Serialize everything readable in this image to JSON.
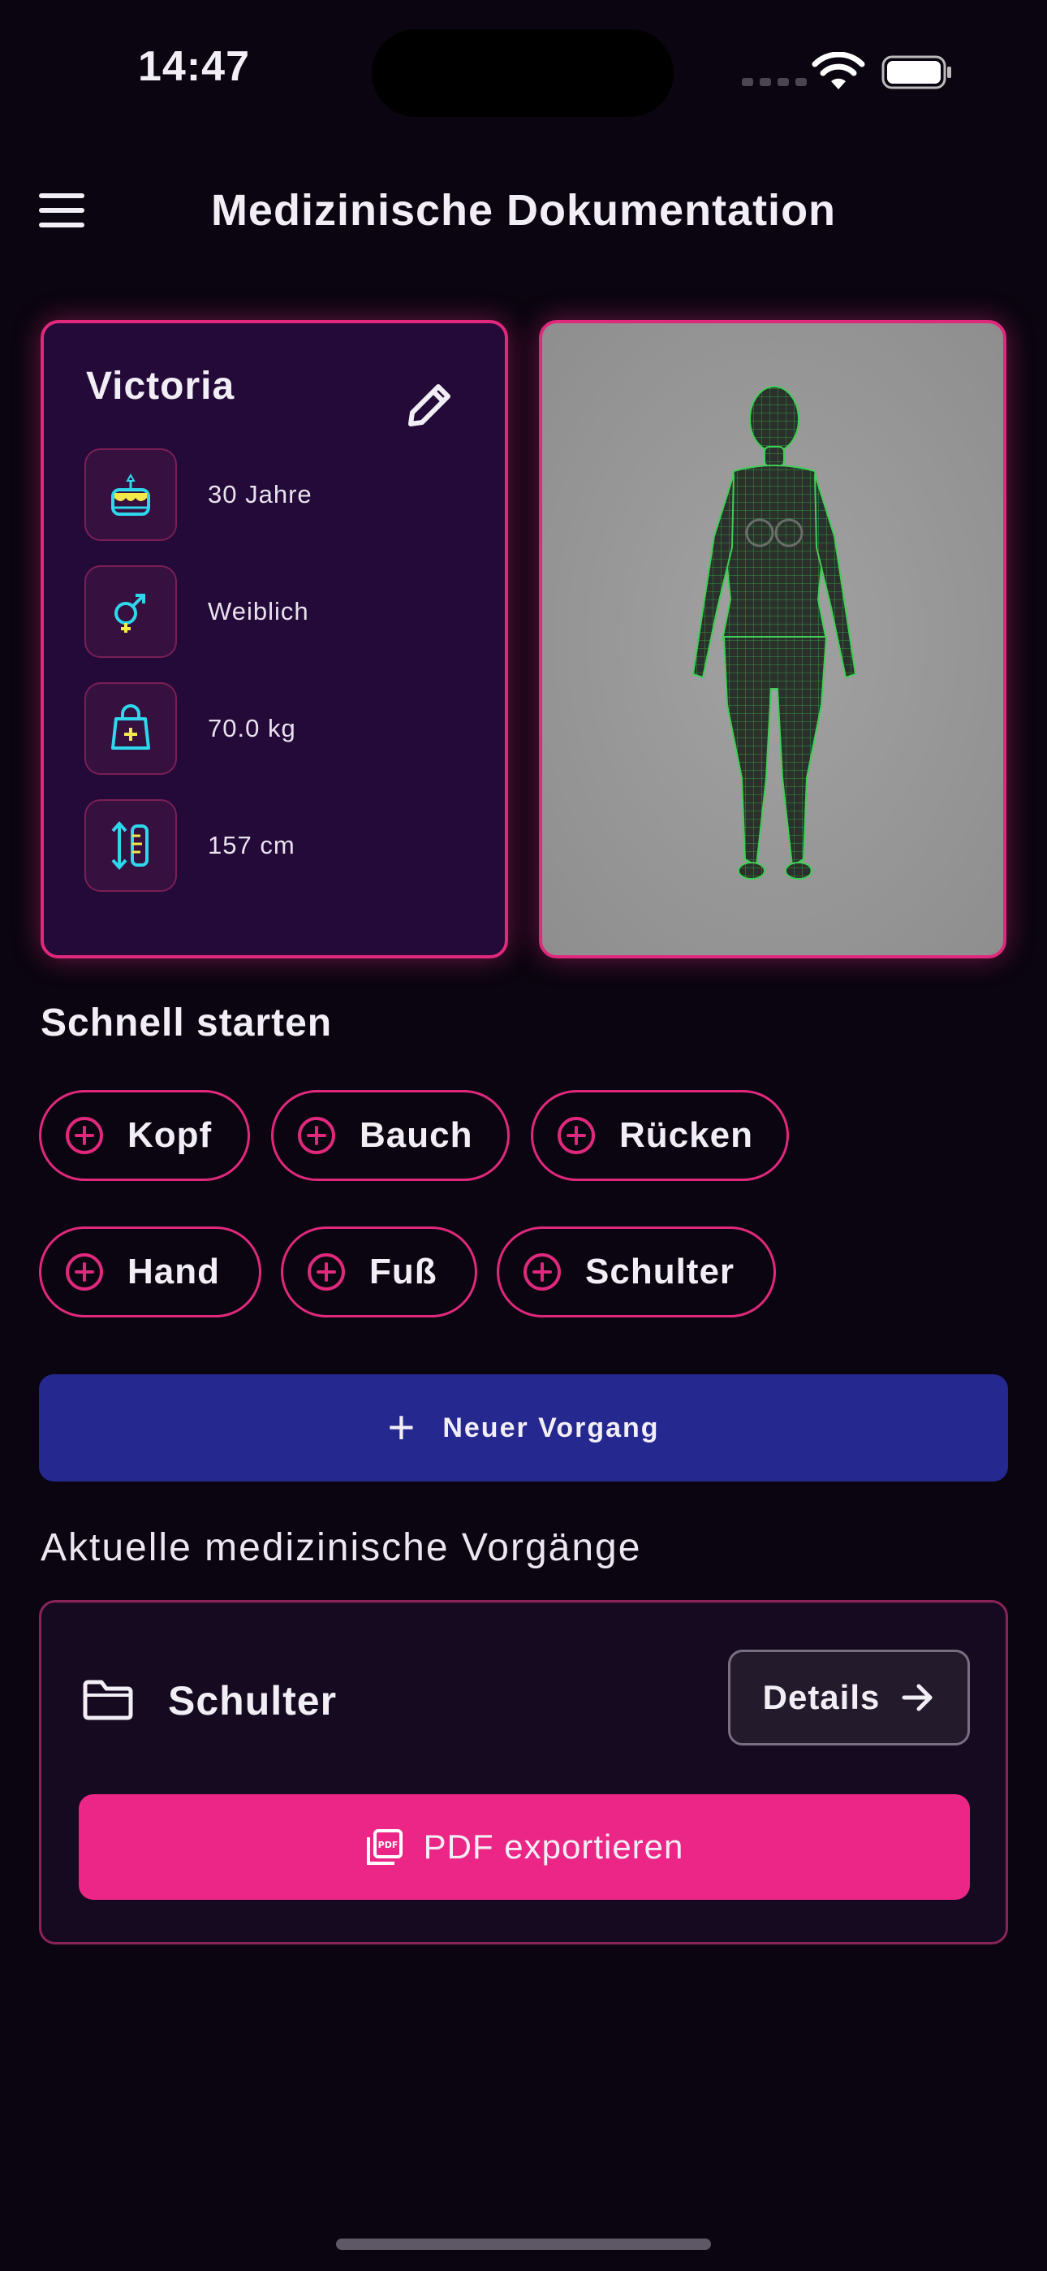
{
  "status_bar": {
    "time": "14:47"
  },
  "header": {
    "title": "Medizinische Dokumentation"
  },
  "profile": {
    "name": "Victoria",
    "age": "30 Jahre",
    "gender": "Weiblich",
    "weight": "70.0 kg",
    "height": "157 cm"
  },
  "quick_start": {
    "title": "Schnell starten",
    "chips": [
      "Kopf",
      "Bauch",
      "Rücken",
      "Hand",
      "Fuß",
      "Schulter"
    ]
  },
  "new_process": {
    "label": "Neuer Vorgang"
  },
  "current": {
    "title": "Aktuelle medizinische Vorgänge",
    "case_name": "Schulter",
    "details_label": "Details",
    "pdf_label": "PDF exportieren"
  },
  "colors": {
    "accent_pink": "#e0287c",
    "button_blue": "#24288f",
    "pdf_pink": "#ec2686",
    "icon_cyan": "#2fd7ec",
    "icon_yellow": "#f2e84a",
    "mesh_green": "#2fe04a"
  }
}
